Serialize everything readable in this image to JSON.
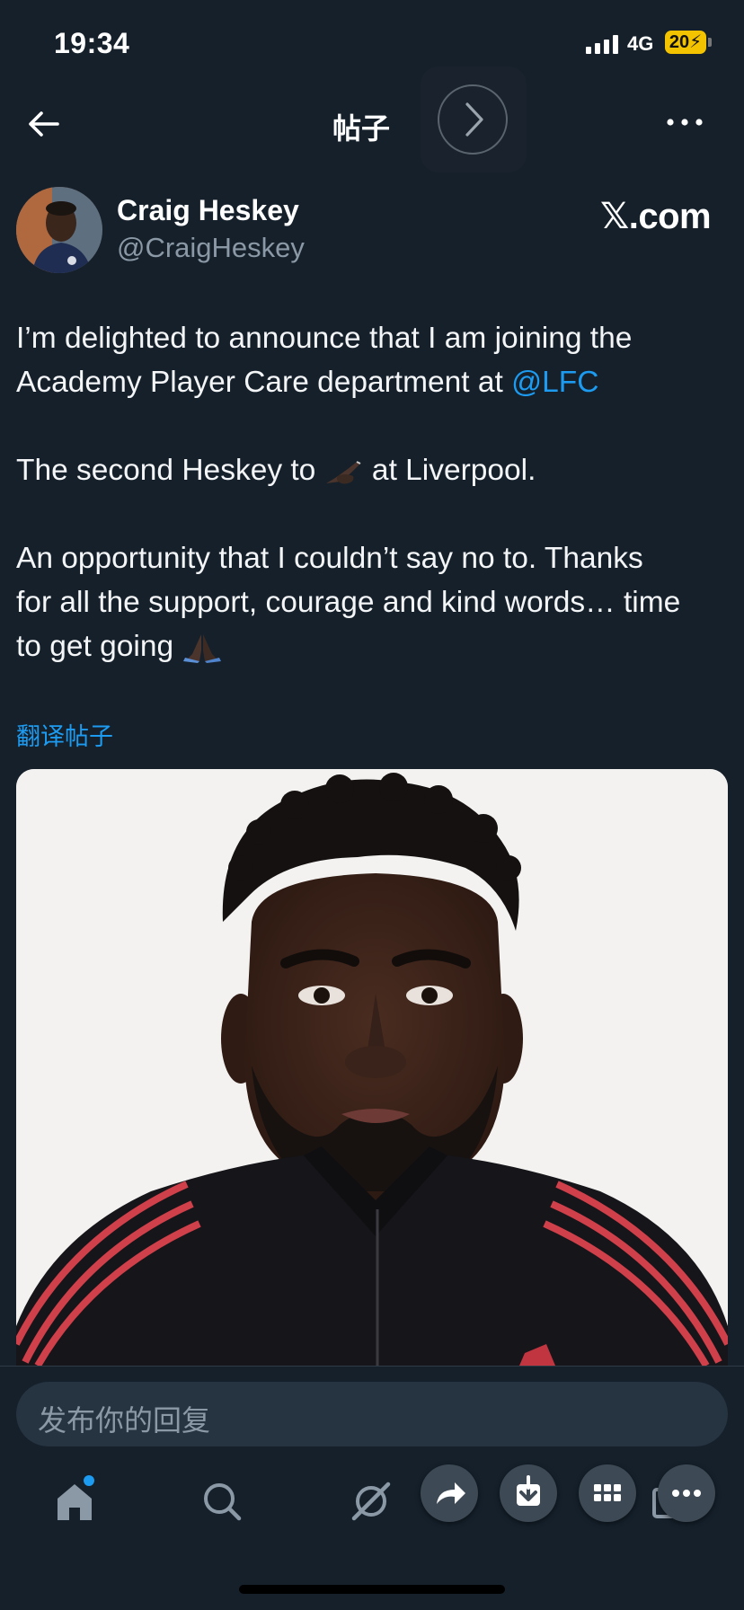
{
  "status_bar": {
    "time": "19:34",
    "network": "4G",
    "battery": "20"
  },
  "header": {
    "title": "帖子"
  },
  "user": {
    "name": "Craig Heskey",
    "handle": "@CraigHeskey"
  },
  "watermark": "𝕏.com",
  "tweet": {
    "line1": "I’m delighted to announce that I am joining the",
    "line2_prefix": "Academy Player Care department at ",
    "mention": "@LFC",
    "line3_prefix": "The second Heskey to ",
    "line3_suffix": " at Liverpool.",
    "line4": "An opportunity that I couldn’t say no to. Thanks",
    "line5": "for all the support, courage and kind words… time",
    "line6_prefix": "to get going "
  },
  "translate_label": "翻译帖子",
  "reply": {
    "placeholder": "发布你的回复"
  },
  "colors": {
    "background": "#15202b",
    "accent": "#1d9bf0",
    "muted": "#8b98a5"
  },
  "icons": {
    "back": "arrow-left-icon",
    "forward": "chevron-right-icon",
    "more": "more-horizontal-icon",
    "home": "home-icon",
    "search": "search-icon",
    "grok": "grok-icon",
    "share": "share-icon",
    "download": "download-icon",
    "grid": "grid-icon",
    "overflow": "more-icon"
  }
}
